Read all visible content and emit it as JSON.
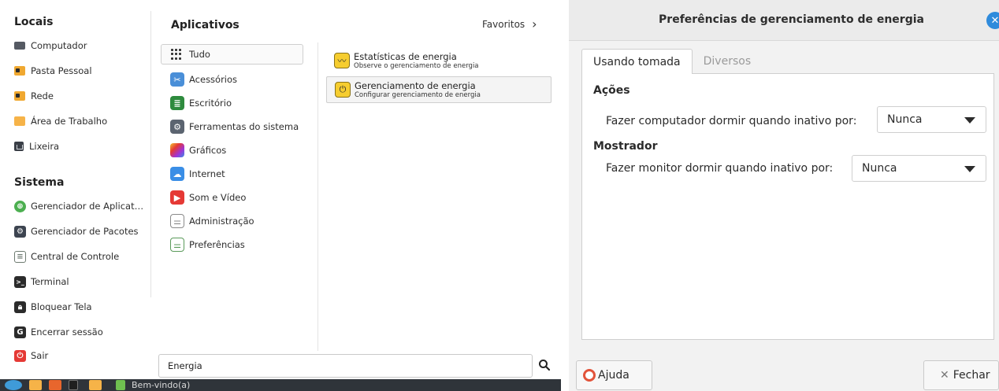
{
  "menu": {
    "places_title": "Locais",
    "places": [
      {
        "label": "Computador",
        "icon": "computer-icon"
      },
      {
        "label": "Pasta Pessoal",
        "icon": "home-folder-icon"
      },
      {
        "label": "Rede",
        "icon": "network-folder-icon"
      },
      {
        "label": "Área de Trabalho",
        "icon": "desktop-folder-icon"
      },
      {
        "label": "Lixeira",
        "icon": "trash-icon"
      }
    ],
    "system_title": "Sistema",
    "system": [
      {
        "label": "Gerenciador de Aplicat…",
        "icon": "software-manager-icon",
        "color": "#4caf50"
      },
      {
        "label": "Gerenciador de Pacotes",
        "icon": "package-manager-icon",
        "color": "#3d4450"
      },
      {
        "label": "Central de Controle",
        "icon": "control-center-icon",
        "color": "#6d7a70"
      },
      {
        "label": "Terminal",
        "icon": "terminal-icon",
        "color": "#2b2b2b"
      },
      {
        "label": "Bloquear Tela",
        "icon": "lock-icon",
        "color": "#2b2b2b"
      },
      {
        "label": "Encerrar sessão",
        "icon": "logout-icon",
        "color": "#2b2b2b"
      },
      {
        "label": "Sair",
        "icon": "power-icon",
        "color": "#e53935"
      }
    ],
    "categories_title": "Aplicativos",
    "favorites_label": "Favoritos",
    "categories": [
      {
        "label": "Tudo",
        "icon": "grid-icon",
        "selected": true
      },
      {
        "label": "Acessórios",
        "icon": "accessories-icon",
        "color": "#4a8fd8"
      },
      {
        "label": "Escritório",
        "icon": "office-icon",
        "color": "#2e8b3e"
      },
      {
        "label": "Ferramentas do sistema",
        "icon": "system-tools-icon",
        "color": "#5b6470"
      },
      {
        "label": "Gráficos",
        "icon": "graphics-icon",
        "color": "#d43cc4"
      },
      {
        "label": "Internet",
        "icon": "internet-icon",
        "color": "#3a8ee6"
      },
      {
        "label": "Som e Vídeo",
        "icon": "sound-video-icon",
        "color": "#e53935"
      },
      {
        "label": "Administração",
        "icon": "administration-icon",
        "color": "#8a8a8a"
      },
      {
        "label": "Preferências",
        "icon": "preferences-icon",
        "color": "#5a9a5a"
      }
    ],
    "apps": [
      {
        "name": "Estatísticas de energia",
        "desc": "Observe o gerenciamento de energia",
        "icon": "power-statistics-icon"
      },
      {
        "name": "Gerenciamento de energia",
        "desc": "Configurar gerenciamento de energia",
        "icon": "power-management-icon"
      }
    ],
    "search_value": "Energia"
  },
  "taskbar": {
    "window_label": "Bem-vindo(a)"
  },
  "dialog": {
    "title": "Preferências de gerenciamento de energia",
    "tabs": [
      "Usando tomada",
      "Diversos"
    ],
    "actions_title": "Ações",
    "sleep_computer_label": "Fazer computador dormir quando inativo por:",
    "sleep_computer_value": "Nunca",
    "display_title": "Mostrador",
    "sleep_display_label": "Fazer monitor dormir quando inativo por:",
    "sleep_display_value": "Nunca",
    "help_label": "Ajuda",
    "close_label": "Fechar"
  }
}
